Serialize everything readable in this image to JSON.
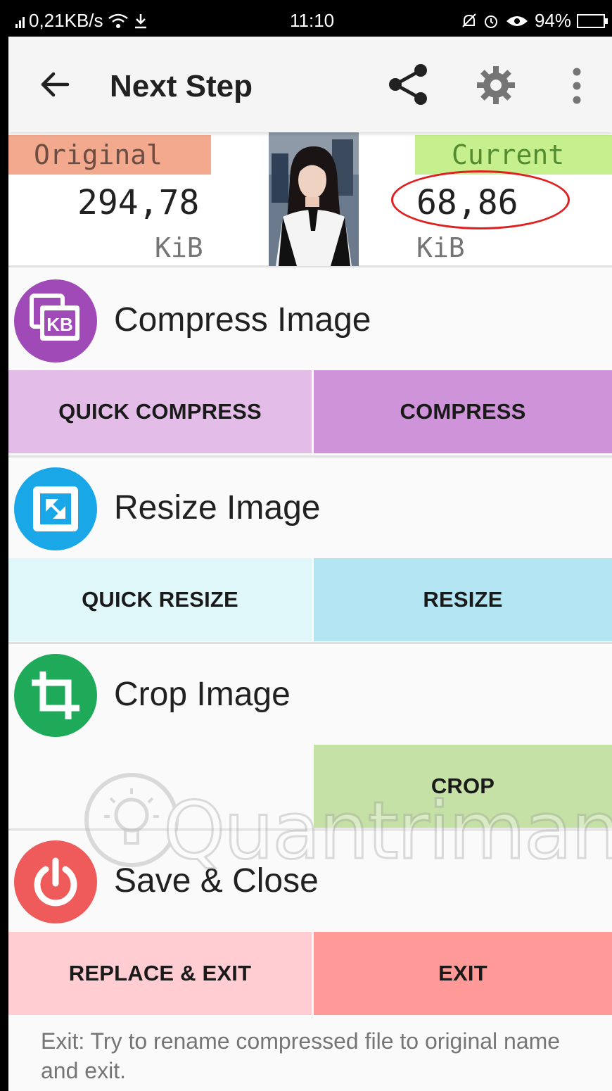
{
  "status_bar": {
    "speed": "0,21KB/s",
    "time": "11:10",
    "battery": "94%"
  },
  "toolbar": {
    "title": "Next Step",
    "icons": [
      "back-arrow-icon",
      "share-icon",
      "gear-icon",
      "more-vert-icon"
    ]
  },
  "size_info": {
    "original_label": "Original",
    "original_value": "294,78",
    "original_unit": "KiB",
    "current_label": "Current",
    "current_value": "68,86",
    "current_unit": "KiB"
  },
  "sections": {
    "compress": {
      "title": "Compress Image",
      "icon_text": "KB",
      "color": "#a04ab8",
      "quick_button": "QUICK COMPRESS",
      "main_button": "COMPRESS",
      "quick_bg": "#e3bde8",
      "main_bg": "#ce93d8"
    },
    "resize": {
      "title": "Resize Image",
      "color": "#1aa7e8",
      "quick_button": "QUICK RESIZE",
      "main_button": "RESIZE",
      "quick_bg": "#e0f7fa",
      "main_bg": "#b3e5f2"
    },
    "crop": {
      "title": "Crop Image",
      "color": "#1faa59",
      "main_button": "CROP",
      "main_bg": "#c5e1a5"
    },
    "save": {
      "title": "Save & Close",
      "color": "#ef5a5a",
      "replace_button": "REPLACE & EXIT",
      "exit_button": "EXIT",
      "replace_bg": "#ffcdd2",
      "exit_bg": "#ff9a98"
    }
  },
  "footer": {
    "line1": "Exit: Try to rename compressed file to original name and exit."
  },
  "watermark": {
    "text": "Quantrimang"
  },
  "annotation": {
    "circle_color": "#e02020"
  }
}
